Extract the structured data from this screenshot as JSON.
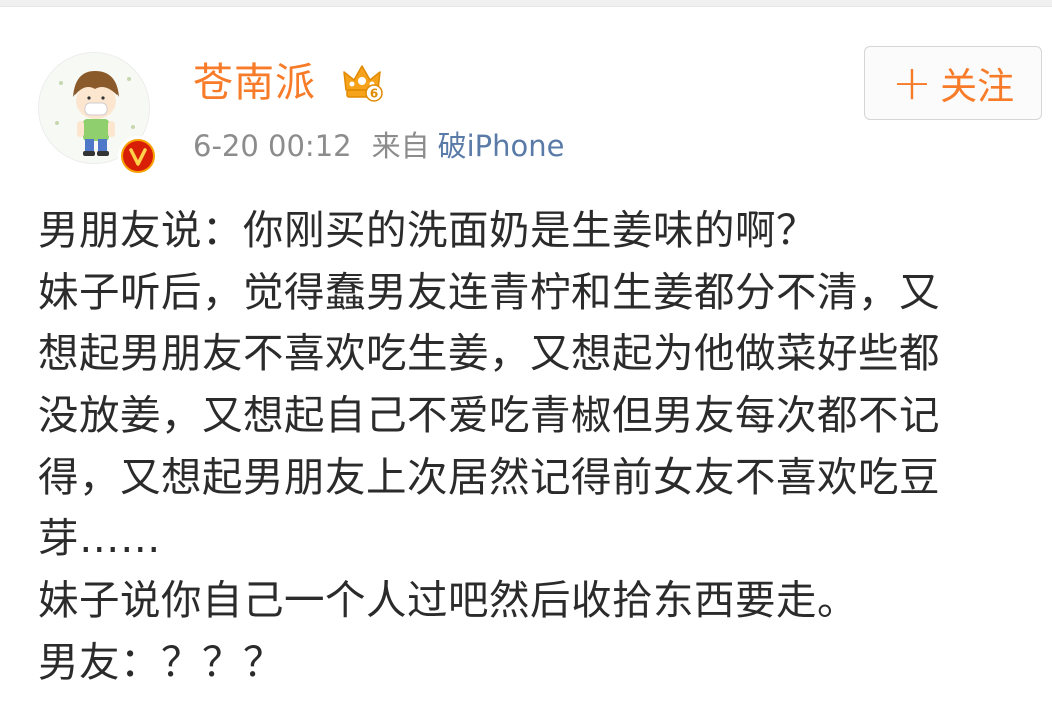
{
  "post": {
    "author": {
      "name": "苍南派",
      "avatar_icon": "cartoon-boy-avatar-icon",
      "verified_icon": "verified-v-badge-icon",
      "vip_icon": "crown-vip-icon",
      "vip_level": "6"
    },
    "meta": {
      "time": "6-20 00:12",
      "source_prefix": "来自",
      "source": "破iPhone"
    },
    "follow_button": {
      "plus": "+",
      "label": "关注"
    },
    "content_lines": [
      "男朋友说：你刚买的洗面奶是生姜味的啊？",
      "妹子听后，觉得蠢男友连青柠和生姜都分不清，又",
      "想起男朋友不喜欢吃生姜，又想起为他做菜好些都",
      "没放姜，又想起自己不爱吃青椒但男友每次都不记",
      "得，又想起男朋友上次居然记得前女友不喜欢吃豆",
      "芽……",
      "妹子说你自己一个人过吧然后收拾东西要走。",
      "男友：？？？"
    ]
  },
  "colors": {
    "accent": "#f77b28",
    "meta_text": "#8c8c8c",
    "link": "#5a7ba8",
    "body_text": "#2b2b2b",
    "verified_badge": "#f7a000"
  }
}
